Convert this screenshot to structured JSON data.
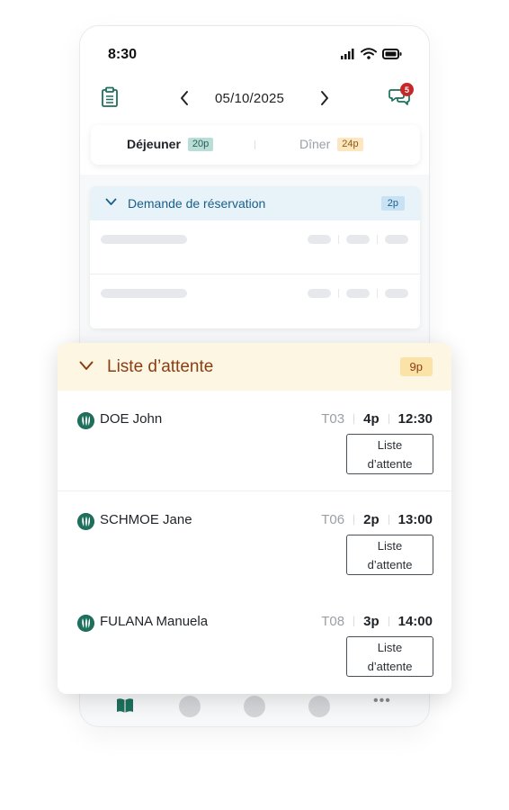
{
  "status_bar": {
    "time": "8:30"
  },
  "header": {
    "date": "05/10/2025",
    "chat_unread_count": "5"
  },
  "meal_tabs": [
    {
      "label": "Déjeuner",
      "count": "20p",
      "active": true
    },
    {
      "label": "Dîner",
      "count": "24p",
      "active": false
    }
  ],
  "reservation_requests": {
    "title": "Demande de réservation",
    "count": "2p"
  },
  "waitlist": {
    "title": "Liste d’attente",
    "count": "9p",
    "entries": [
      {
        "name": "DOE John",
        "table": "T03",
        "party": "4p",
        "time": "12:30",
        "button_label": "Liste\nd’attente"
      },
      {
        "name": "SCHMOE Jane",
        "table": "T06",
        "party": "2p",
        "time": "13:00",
        "button_label": "Liste\nd’attente"
      },
      {
        "name": "FULANA Manuela",
        "table": "T08",
        "party": "3p",
        "time": "14:00",
        "button_label": "Liste\nd’attente"
      }
    ]
  },
  "bottom_nav": {
    "more_label": "•••"
  },
  "colors": {
    "brand_green": "#1e6f5c",
    "waitlist_header_bg": "#fdf6e3",
    "waitlist_accent": "#8a3d12",
    "request_header_bg": "#e8f2f9",
    "request_accent": "#1a5f8a",
    "badge_red": "#c62828"
  }
}
